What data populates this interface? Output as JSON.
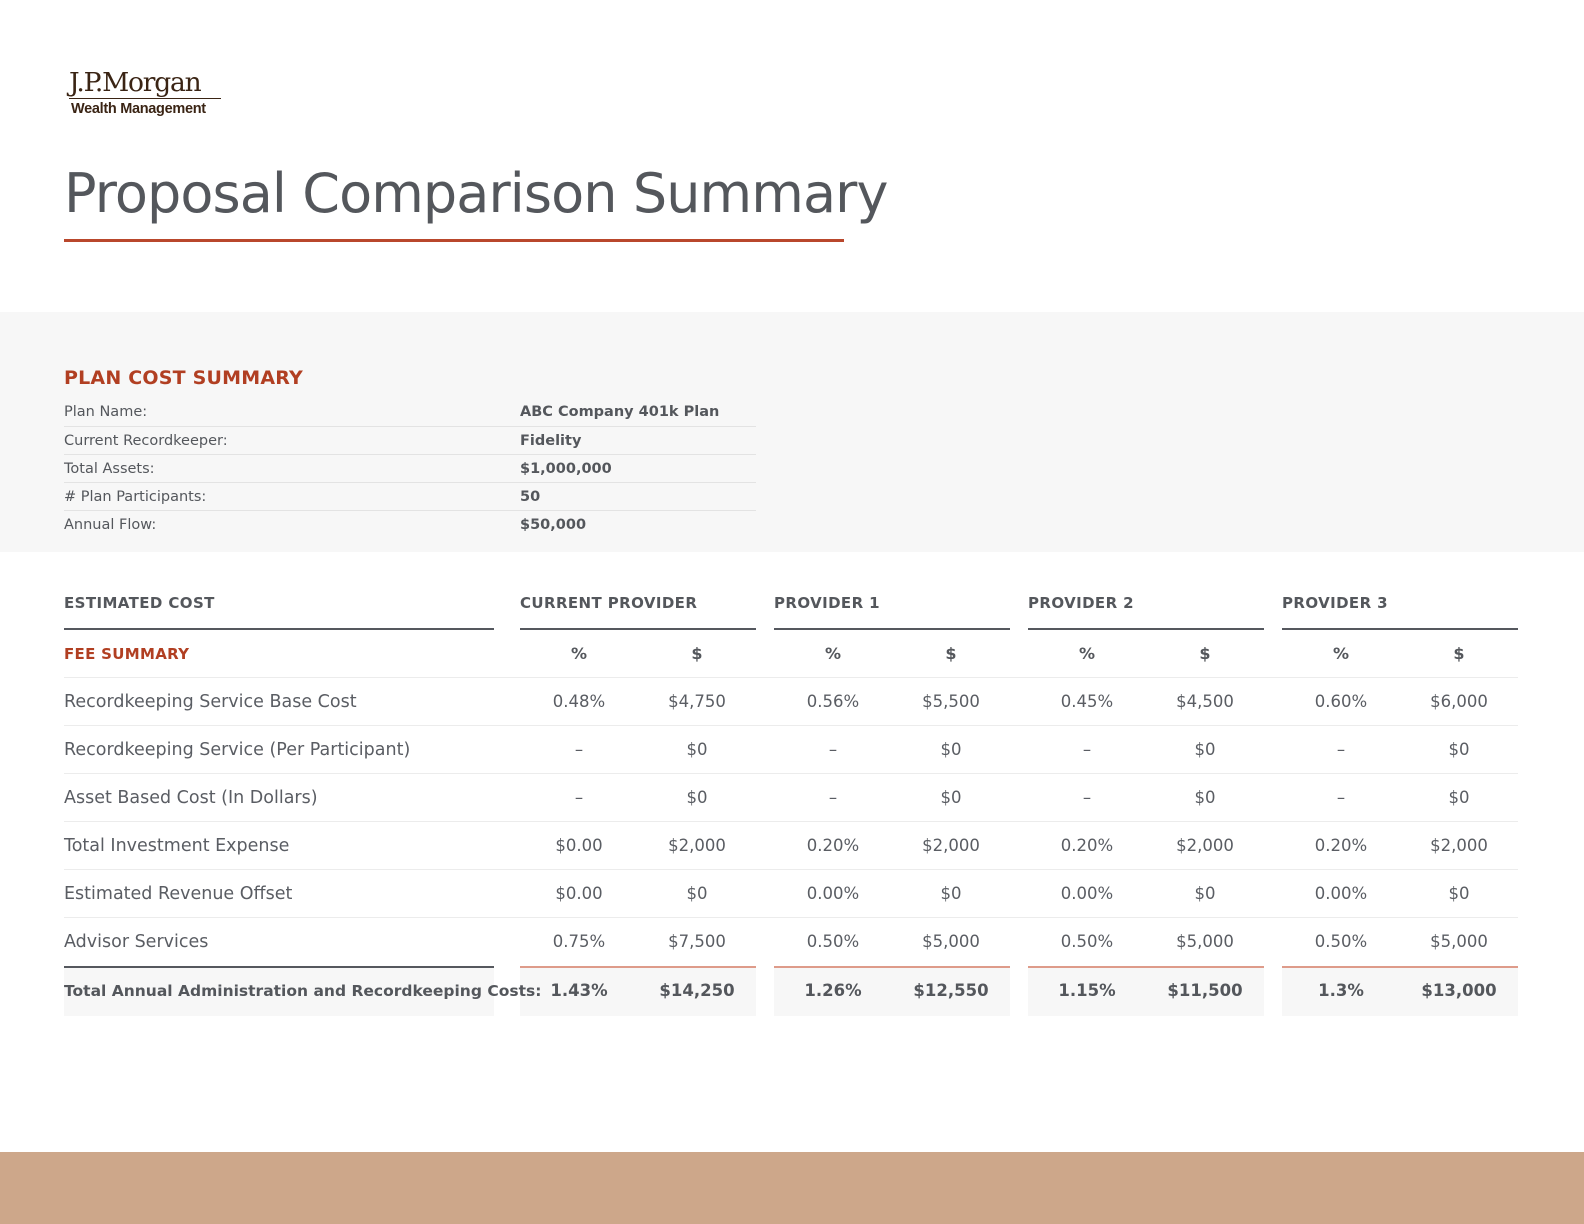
{
  "logo": {
    "brand": "J.P.Morgan",
    "division": "Wealth Management"
  },
  "page_title": "Proposal Comparison Summary",
  "plan_cost_summary": {
    "heading": "PLAN COST SUMMARY",
    "rows": [
      {
        "label": "Plan Name:",
        "value": "ABC Company 401k Plan"
      },
      {
        "label": "Current Recordkeeper:",
        "value": "Fidelity"
      },
      {
        "label": "Total Assets:",
        "value": "$1,000,000"
      },
      {
        "label": "# Plan Participants:",
        "value": "50"
      },
      {
        "label": "Annual Flow:",
        "value": "$50,000"
      }
    ]
  },
  "cost_table": {
    "estimated_cost_header": "ESTIMATED COST",
    "providers": [
      "CURRENT PROVIDER",
      "PROVIDER 1",
      "PROVIDER 2",
      "PROVIDER 3"
    ],
    "fee_summary_label": "FEE SUMMARY",
    "pct_header": "%",
    "usd_header": "$",
    "rows": [
      {
        "label": "Recordkeeping Service Base Cost",
        "cells": [
          "0.48%",
          "$4,750",
          "0.56%",
          "$5,500",
          "0.45%",
          "$4,500",
          "0.60%",
          "$6,000"
        ]
      },
      {
        "label": "Recordkeeping Service (Per Participant)",
        "cells": [
          "–",
          "$0",
          "–",
          "$0",
          "–",
          "$0",
          "–",
          "$0"
        ]
      },
      {
        "label": "Asset Based Cost (In Dollars)",
        "cells": [
          "–",
          "$0",
          "–",
          "$0",
          "–",
          "$0",
          "–",
          "$0"
        ]
      },
      {
        "label": "Total Investment Expense",
        "cells": [
          "$0.00",
          "$2,000",
          "0.20%",
          "$2,000",
          "0.20%",
          "$2,000",
          "0.20%",
          "$2,000"
        ]
      },
      {
        "label": "Estimated Revenue Offset",
        "cells": [
          "$0.00",
          "$0",
          "0.00%",
          "$0",
          "0.00%",
          "$0",
          "0.00%",
          "$0"
        ]
      },
      {
        "label": "Advisor Services",
        "cells": [
          "0.75%",
          "$7,500",
          "0.50%",
          "$5,000",
          "0.50%",
          "$5,000",
          "0.50%",
          "$5,000"
        ]
      }
    ],
    "total": {
      "label": "Total Annual Administration and Recordkeeping Costs:",
      "cells": [
        "1.43%",
        "$14,250",
        "1.26%",
        "$12,550",
        "1.15%",
        "$11,500",
        "1.3%",
        "$13,000"
      ]
    }
  },
  "colors": {
    "accent_red": "#b13f22",
    "title_underline": "#b9472c",
    "footer_tan": "#cda78a",
    "brand_brown": "#3a2414"
  }
}
